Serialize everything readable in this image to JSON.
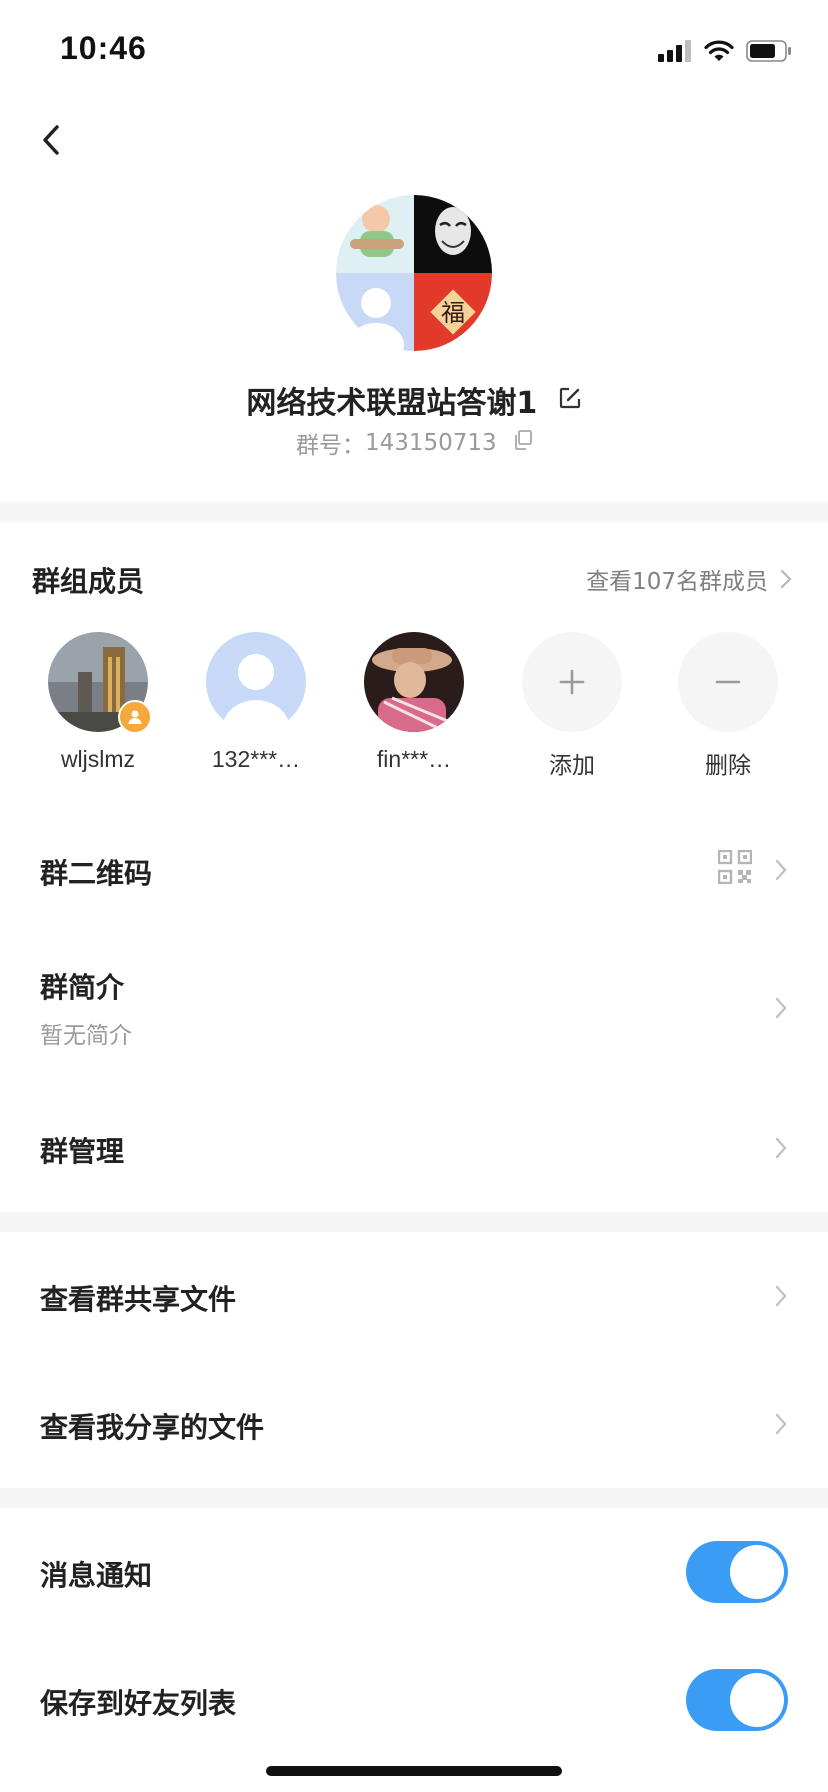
{
  "status": {
    "time": "10:46"
  },
  "group": {
    "name": "网络技术联盟站答谢1",
    "id_label": "群号：",
    "id_value": "143150713"
  },
  "members": {
    "title": "群组成员",
    "view_all": "查看107名群成员",
    "list": [
      {
        "name": "wljslmz"
      },
      {
        "name": "132***…"
      },
      {
        "name": "fin***…"
      }
    ],
    "add_label": "添加",
    "remove_label": "删除"
  },
  "settings": {
    "qr_code": "群二维码",
    "intro": "群简介",
    "intro_value": "暂无简介",
    "manage": "群管理",
    "shared_files": "查看群共享文件",
    "my_shared_files": "查看我分享的文件",
    "notifications": {
      "label": "消息通知",
      "on": true
    },
    "save_to_contacts": {
      "label": "保存到好友列表",
      "on": true
    }
  },
  "colors": {
    "accent": "#3b9cf6",
    "section_gap": "#f5f5f5",
    "avatar_blue": "#c8d9f7",
    "blessing_red": "#e23a2a"
  }
}
